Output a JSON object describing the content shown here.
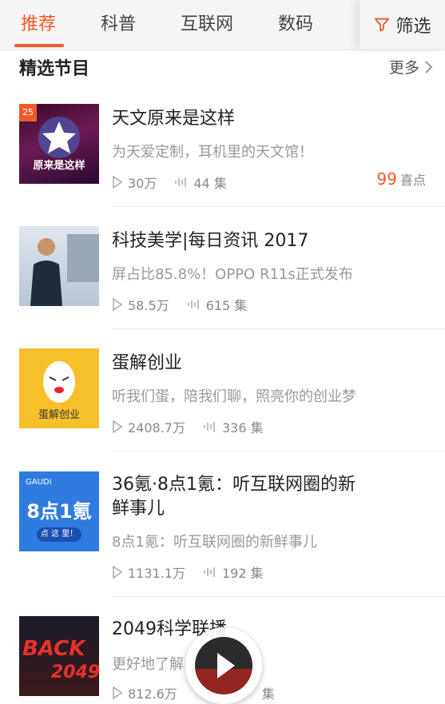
{
  "tabs": [
    {
      "label": "推荐",
      "active": true
    },
    {
      "label": "科普",
      "active": false
    },
    {
      "label": "互联网",
      "active": false
    },
    {
      "label": "数码",
      "active": false
    }
  ],
  "filter": {
    "label": "筛选",
    "icon": "filter-icon"
  },
  "section": {
    "title": "精选节目",
    "more": "更多"
  },
  "items": [
    {
      "title": "天文原来是这样",
      "subtitle": "为天爱定制，耳机里的天文馆！",
      "plays": "30万",
      "episodes": "44 集",
      "likes_num": "99",
      "likes_label": "喜点",
      "cover_text": "原来是这样",
      "cover_badge": "25"
    },
    {
      "title": "科技美学|每日资讯 2017",
      "subtitle": "屏占比85.8%！OPPO R11s正式发布",
      "plays": "58.5万",
      "episodes": "615 集"
    },
    {
      "title": "蛋解创业",
      "subtitle": "听我们蛋，陪我们聊，照亮你的创业梦",
      "plays": "2408.7万",
      "episodes": "336 集",
      "cover_text": "蛋解创业"
    },
    {
      "title_line1": "36氪·8点1氪：听互联网圈的新",
      "title_line2": "鲜事儿",
      "subtitle": "8点1氪：听互联网圈的新鲜事儿",
      "plays": "1131.1万",
      "episodes": "192 集",
      "cover_brand": "GAUDI",
      "cover_big": "8点1氪",
      "cover_btn": "点 这 里！"
    },
    {
      "title": "2049科学联播",
      "subtitle": "更好地了解",
      "plays": "812.6万",
      "episodes": "集",
      "cover_text1": "BACK",
      "cover_text2": "2049"
    }
  ],
  "colors": {
    "accent": "#f05a28",
    "tab_bg": "#f5f5f5",
    "muted": "#999999"
  }
}
